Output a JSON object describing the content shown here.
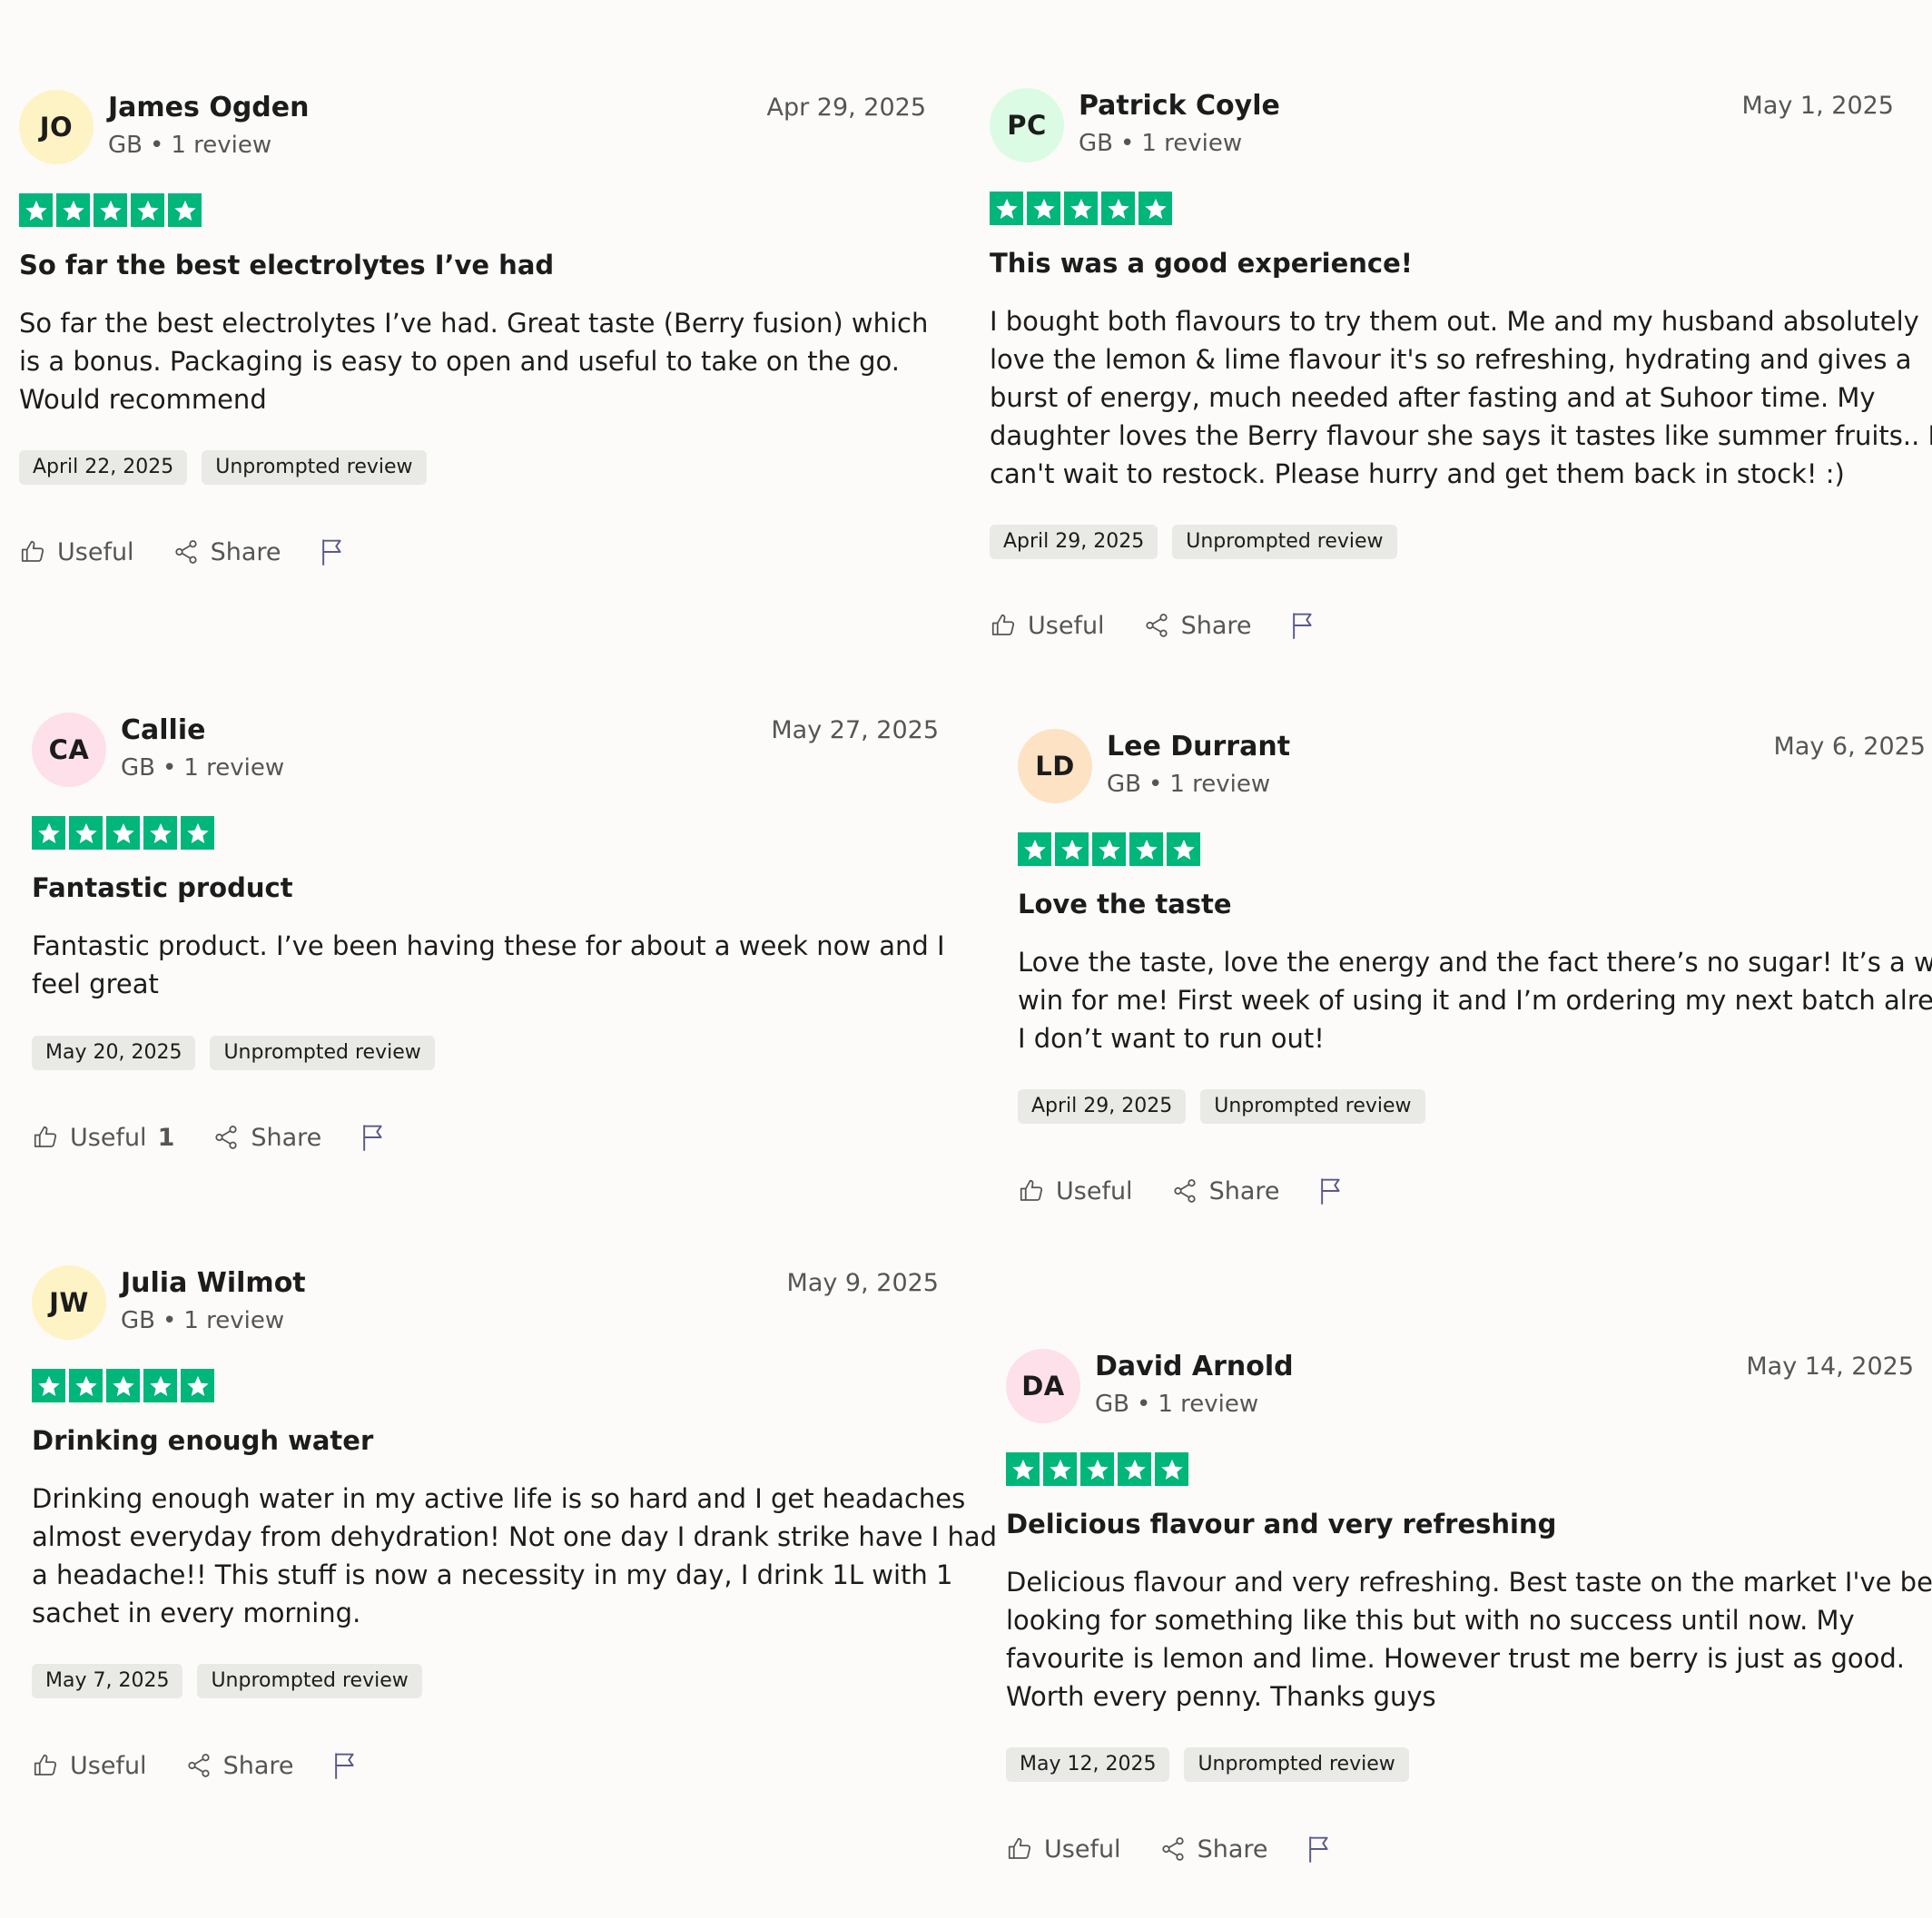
{
  "reviews": [
    {
      "initials": "JO",
      "avatar_color": "#fdf3c4",
      "name": "James Ogden",
      "country": "GB",
      "review_count": "1 review",
      "date": "Apr 29, 2025",
      "rating": 5,
      "title": "So far the best electrolytes I’ve had",
      "body_lines": [
        "So far the best electrolytes I’ve had. Great taste (Berry fusion) which",
        "is a bonus. Packaging is easy to open and useful to take on the go.",
        "Would recommend"
      ],
      "experience_date": "April 22, 2025",
      "badge": "Unprompted review",
      "useful_label": "Useful",
      "useful_count": "",
      "share_label": "Share"
    },
    {
      "initials": "PC",
      "avatar_color": "#dcfbe4",
      "name": "Patrick Coyle",
      "country": "GB",
      "review_count": "1 review",
      "date": "May 1, 2025",
      "rating": 5,
      "title": "This was a good experience!",
      "body_lines": [
        "I bought both flavours to try them out. Me and my husband absolutely",
        "love the lemon & lime flavour it's so refreshing, hydrating and gives a",
        "burst of energy, much needed after fasting and at Suhoor time. My",
        "daughter loves the Berry flavour she says it tastes like summer fruits.. I",
        "can't wait to restock. Please hurry and get them back in stock! :)"
      ],
      "experience_date": "April 29, 2025",
      "badge": "Unprompted review",
      "useful_label": "Useful",
      "useful_count": "",
      "share_label": "Share"
    },
    {
      "initials": "CA",
      "avatar_color": "#fde0ea",
      "name": "Callie",
      "country": "GB",
      "review_count": "1 review",
      "date": "May 27, 2025",
      "rating": 5,
      "title": "Fantastic product",
      "body_lines": [
        "Fantastic product. I’ve been having these for about a week now and I",
        "feel great"
      ],
      "experience_date": "May 20, 2025",
      "badge": "Unprompted review",
      "useful_label": "Useful",
      "useful_count": "1",
      "share_label": "Share"
    },
    {
      "initials": "LD",
      "avatar_color": "#fde2c4",
      "name": "Lee Durrant",
      "country": "GB",
      "review_count": "1 review",
      "date": "May 6, 2025",
      "rating": 5,
      "title": "Love the taste",
      "body_lines": [
        "Love the taste, love the energy and the fact there’s no sugar! It’s a win",
        "win for me! First week of using it and I’m ordering my next batch already,",
        "I don’t want to run out!"
      ],
      "experience_date": "April 29, 2025",
      "badge": "Unprompted review",
      "useful_label": "Useful",
      "useful_count": "",
      "share_label": "Share"
    },
    {
      "initials": "JW",
      "avatar_color": "#fdf3c4",
      "name": "Julia Wilmot",
      "country": "GB",
      "review_count": "1 review",
      "date": "May 9, 2025",
      "rating": 5,
      "title": "Drinking enough water",
      "body_lines": [
        "Drinking enough water in my active life is so hard and I get headaches",
        "almost everyday from dehydration! Not one day I drank strike have I had",
        "a headache!! This stuff is now a necessity in my day, I drink 1L with 1",
        "sachet in every morning."
      ],
      "experience_date": "May 7, 2025",
      "badge": "Unprompted review",
      "useful_label": "Useful",
      "useful_count": "",
      "share_label": "Share"
    },
    {
      "initials": "DA",
      "avatar_color": "#fde0ea",
      "name": "David Arnold",
      "country": "GB",
      "review_count": "1 review",
      "date": "May 14, 2025",
      "rating": 5,
      "title": "Delicious flavour and very refreshing",
      "body_lines": [
        "Delicious flavour and very refreshing. Best taste on the market I've been",
        "looking for something like this but with no success until now. My",
        "favourite is lemon and lime. However trust me berry is just as good.",
        "Worth every penny. Thanks guys"
      ],
      "experience_date": "May 12, 2025",
      "badge": "Unprompted review",
      "useful_label": "Useful",
      "useful_count": "",
      "share_label": "Share"
    }
  ],
  "colors": {
    "star_green": "#00b67a",
    "badge_bg": "#e9e9e6",
    "muted_text": "#555555",
    "flag_icon": "#5a5a8a"
  }
}
